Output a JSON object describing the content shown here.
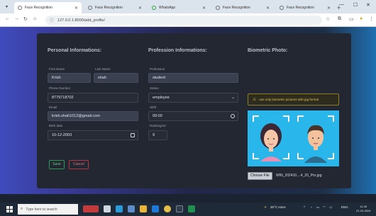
{
  "browser": {
    "tabs": [
      {
        "label": "Face Recognition",
        "active": true,
        "favicon": "globe-icon"
      },
      {
        "label": "Face Recognition",
        "active": false,
        "favicon": "globe-icon"
      },
      {
        "label": "WhatsApp",
        "active": false,
        "favicon": "whatsapp-icon"
      },
      {
        "label": "Face Recognition",
        "active": false,
        "favicon": "globe-icon"
      },
      {
        "label": "Face Recognition",
        "active": false,
        "favicon": "globe-icon"
      }
    ],
    "url": "127.0.0.1:8000/add_profile/"
  },
  "form": {
    "personal": {
      "title": "Personal Informations:",
      "first_name_label": "First Name",
      "first_name": "Krish",
      "last_name_label": "Last Name",
      "last_name": "shah",
      "phone_label": "Phone Number",
      "phone": "8779718702",
      "email_label": "Email",
      "email": "krish.shah1012@gmail.com",
      "dob_label": "Birth date",
      "dob": "10-12-2003"
    },
    "profession": {
      "title": "Profession Informations:",
      "profession_label": "Profession",
      "profession": "student",
      "status_label": "Status",
      "status": "employee",
      "shift_label": "Shift",
      "shift": "09:00",
      "ranking_label": "Ranking/10",
      "ranking": "9"
    },
    "biometric": {
      "title": "Biometric Photo:",
      "warning": "use only biometric pictures with jpg format",
      "choose_file": "Choose File",
      "file_name": "WIN_202410....4_20_Pro.jpg"
    },
    "buttons": {
      "save": "Save",
      "cancel": "Cancel"
    }
  },
  "taskbar": {
    "search_placeholder": "Type here to search",
    "weather": "30°C Haze",
    "language": "ENG",
    "time": "11:40",
    "date": "21-10-2024"
  },
  "colors": {
    "accent_save": "#2f9a56",
    "accent_cancel": "#b23a45",
    "warning": "#e4c345",
    "biometric_bg": "#29b6ea"
  }
}
